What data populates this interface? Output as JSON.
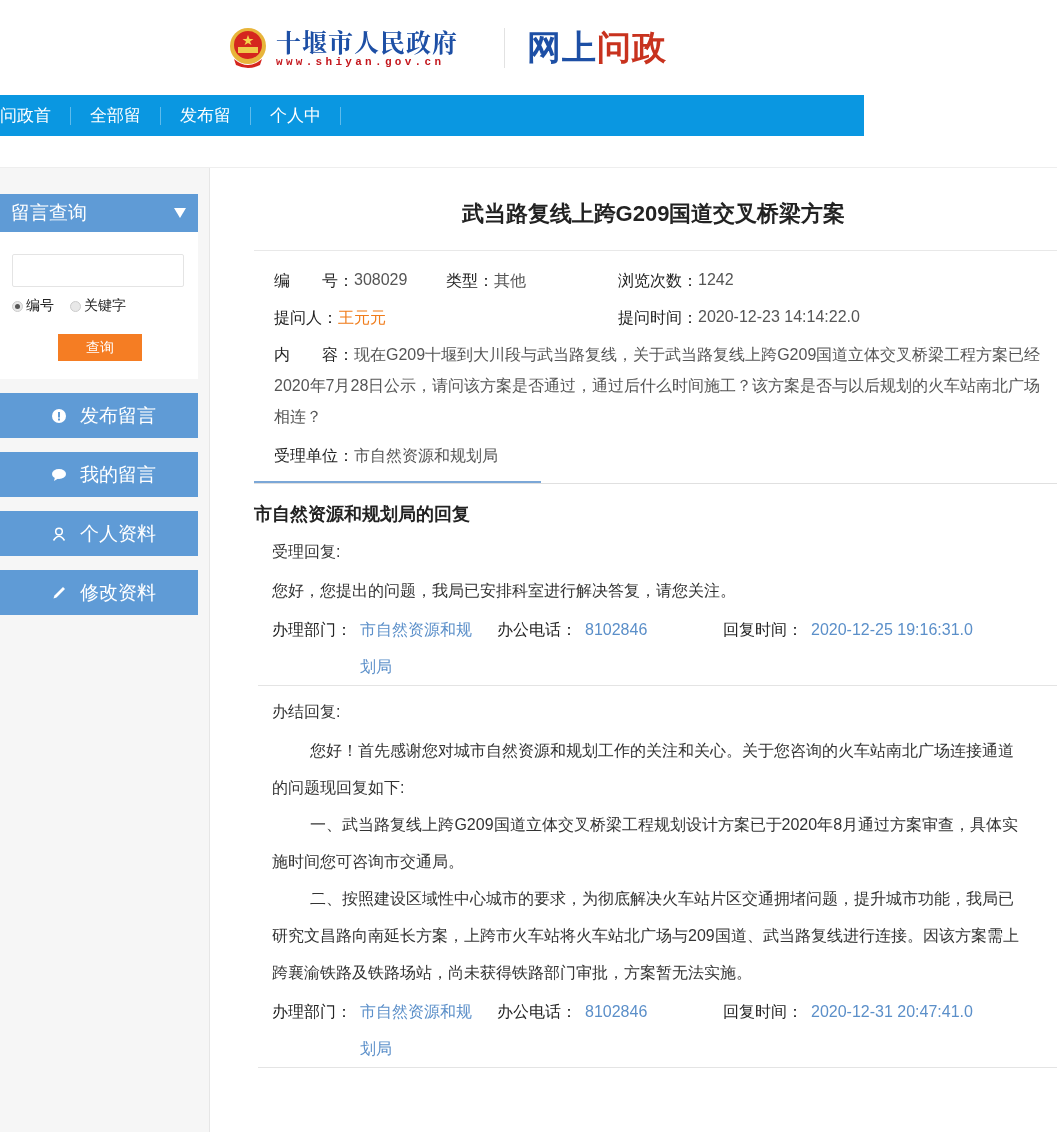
{
  "header": {
    "site_name": "十堰市人民政府",
    "site_url": "www.shiyan.gov.cn",
    "brand": "网上问政"
  },
  "nav": {
    "items": [
      {
        "label": "问政首"
      },
      {
        "label": "全部留"
      },
      {
        "label": "发布留"
      },
      {
        "label": "个人中"
      }
    ]
  },
  "sidebar": {
    "search": {
      "title": "留言查询",
      "radios": [
        {
          "label": "编号",
          "selected": true
        },
        {
          "label": "关键字",
          "selected": false
        }
      ],
      "button": "查询"
    },
    "menu": [
      {
        "label": "发布留言",
        "kind": "exclamation"
      },
      {
        "label": "我的留言",
        "kind": "comment"
      },
      {
        "label": "个人资料",
        "kind": "person"
      },
      {
        "label": "修改资料",
        "kind": "pencil"
      }
    ]
  },
  "question": {
    "title": "武当路复线上跨G209国道交叉桥梁方案",
    "number": {
      "label": "编　　号：",
      "value": "308029"
    },
    "type": {
      "label": "类型：",
      "value": "其他"
    },
    "views": {
      "label": "浏览次数：",
      "value": "1242"
    },
    "asker": {
      "label": "提问人：",
      "value": "王元元"
    },
    "asked_time": {
      "label": "提问时间：",
      "value": "2020-12-23 14:14:22.0"
    },
    "content": {
      "label": "内　　容：",
      "value": "现在G209十堰到大川段与武当路复线，关于武当路复线上跨G209国道立体交叉桥梁工程方案已经2020年7月28日公示，请问该方案是否通过，通过后什么时间施工？该方案是否与以后规划的火车站南北广场相连？"
    },
    "unit": {
      "label": "受理单位：",
      "value": "市自然资源和规划局"
    }
  },
  "reply_tab": {
    "title": "市自然资源和规划局的回复"
  },
  "replies": [
    {
      "heading": "受理回复:",
      "paragraphs": [
        {
          "indent": false,
          "lines": [
            "您好，您提出的问题，我局已安排科室进行解决答复，请您关注。"
          ]
        }
      ],
      "dept": {
        "label": "办理部门：",
        "value": "市自然资源和规划局"
      },
      "phone": {
        "label": "办公电话：",
        "value": "8102846"
      },
      "time": {
        "label": "回复时间：",
        "value": "2020-12-25 19:16:31.0"
      }
    },
    {
      "heading": "办结回复:",
      "paragraphs": [
        {
          "indent": true,
          "lines": [
            "您好！首先感谢您对城市自然资源和规划工作的关注和关心。关于您咨询的火车站南北广场连接通道",
            "的问题现回复如下:"
          ]
        },
        {
          "indent": true,
          "lines": [
            "一、武当路复线上跨G209国道立体交叉桥梁工程规划设计方案已于2020年8月通过方案审查，具体实",
            "施时间您可咨询市交通局。"
          ]
        },
        {
          "indent": true,
          "lines": [
            "二、按照建设区域性中心城市的要求，为彻底解决火车站片区交通拥堵问题，提升城市功能，我局已",
            "研究文昌路向南延长方案，上跨市火车站将火车站北广场与209国道、武当路复线进行连接。因该方案需上",
            "跨襄渝铁路及铁路场站，尚未获得铁路部门审批，方案暂无法实施。"
          ]
        }
      ],
      "dept": {
        "label": "办理部门：",
        "value": "市自然资源和规划局"
      },
      "phone": {
        "label": "办公电话：",
        "value": "8102846"
      },
      "time": {
        "label": "回复时间：",
        "value": "2020-12-31 20:47:41.0"
      }
    }
  ]
}
